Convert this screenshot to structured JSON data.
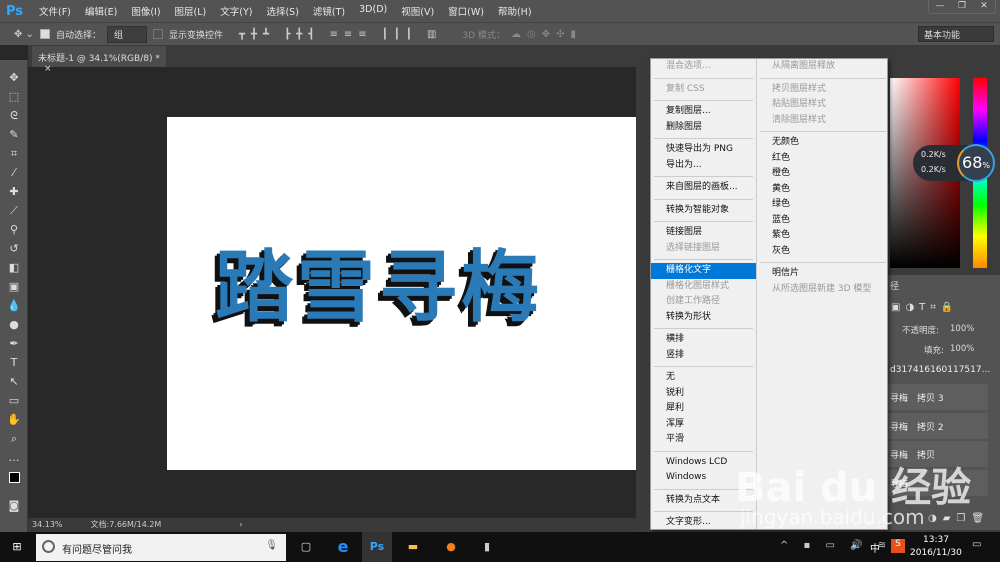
{
  "app": {
    "logo": "Ps"
  },
  "menu": [
    "文件(F)",
    "编辑(E)",
    "图像(I)",
    "图层(L)",
    "文字(Y)",
    "选择(S)",
    "滤镜(T)",
    "3D(D)",
    "视图(V)",
    "窗口(W)",
    "帮助(H)"
  ],
  "window_buttons": [
    "—",
    "❐",
    "✕"
  ],
  "options": {
    "auto_select_label": "自动选择：",
    "auto_select_value": "组",
    "show_transform": "显示变换控件",
    "mode_3d": "3D 模式：",
    "workspace": "基本功能"
  },
  "document_tab": {
    "title": "未标题-1 @ 34.1%(RGB/8) *",
    "close": "×"
  },
  "canvas_text": "踏雪寻梅",
  "status": {
    "zoom": "34.13%",
    "doc": "文档:7.66M/14.2M",
    "arrow": "›"
  },
  "context_menu": {
    "left": [
      [
        "混合选项...",
        "dis"
      ],
      "sep",
      [
        "复制 CSS",
        "dis"
      ],
      "sep",
      [
        "复制图层...",
        ""
      ],
      [
        "删除图层",
        ""
      ],
      "sep",
      [
        "快速导出为 PNG",
        ""
      ],
      [
        "导出为...",
        ""
      ],
      "sep",
      [
        "来自图层的画板...",
        ""
      ],
      "sep",
      [
        "转换为智能对象",
        ""
      ],
      "sep",
      [
        "链接图层",
        ""
      ],
      [
        "选择链接图层",
        "dis"
      ],
      "sep",
      [
        "栅格化文字",
        "hl"
      ],
      [
        "栅格化图层样式",
        "dis"
      ],
      [
        "创建工作路径",
        "dis"
      ],
      [
        "转换为形状",
        ""
      ],
      "sep",
      [
        "横排",
        ""
      ],
      [
        "竖排",
        ""
      ],
      "sep",
      [
        "无",
        ""
      ],
      [
        "锐利",
        ""
      ],
      [
        "犀利",
        ""
      ],
      [
        "浑厚",
        ""
      ],
      [
        "平滑",
        ""
      ],
      "sep",
      [
        "Windows LCD",
        ""
      ],
      [
        "Windows",
        ""
      ],
      "sep",
      [
        "转换为点文本",
        ""
      ],
      "sep",
      [
        "文字变形...",
        ""
      ]
    ],
    "right": [
      [
        "从隔离图层释放",
        "dis"
      ],
      "sep",
      [
        "拷贝图层样式",
        "dis"
      ],
      [
        "粘贴图层样式",
        "dis"
      ],
      [
        "清除图层样式",
        "dis"
      ],
      "sep",
      [
        "无颜色",
        ""
      ],
      [
        "红色",
        ""
      ],
      [
        "橙色",
        ""
      ],
      [
        "黄色",
        ""
      ],
      [
        "绿色",
        ""
      ],
      [
        "蓝色",
        ""
      ],
      [
        "紫色",
        ""
      ],
      [
        "灰色",
        ""
      ],
      "sep",
      [
        "明信片",
        ""
      ],
      [
        "从所选图层新建 3D 模型",
        "dis"
      ]
    ]
  },
  "net_widget": {
    "up": "0.2K/s",
    "down": "0.2K/s",
    "percent": "68",
    "unit": "%"
  },
  "layers": {
    "tab": "径",
    "opacity_label": "不透明度:",
    "opacity": "100%",
    "fill_label": "填充:",
    "fill": "100%",
    "rows": [
      "d317416160117517...",
      "寻梅　拷贝 3",
      "寻梅　拷贝 2",
      "寻梅　拷贝",
      "寻梅"
    ]
  },
  "taskbar": {
    "search": "有问题尽管问我",
    "ime": "中",
    "time": "13:37",
    "date": "2016/11/30"
  },
  "watermark": {
    "brand": "Bai du 经验",
    "url": "jingyan.baidu.com"
  }
}
